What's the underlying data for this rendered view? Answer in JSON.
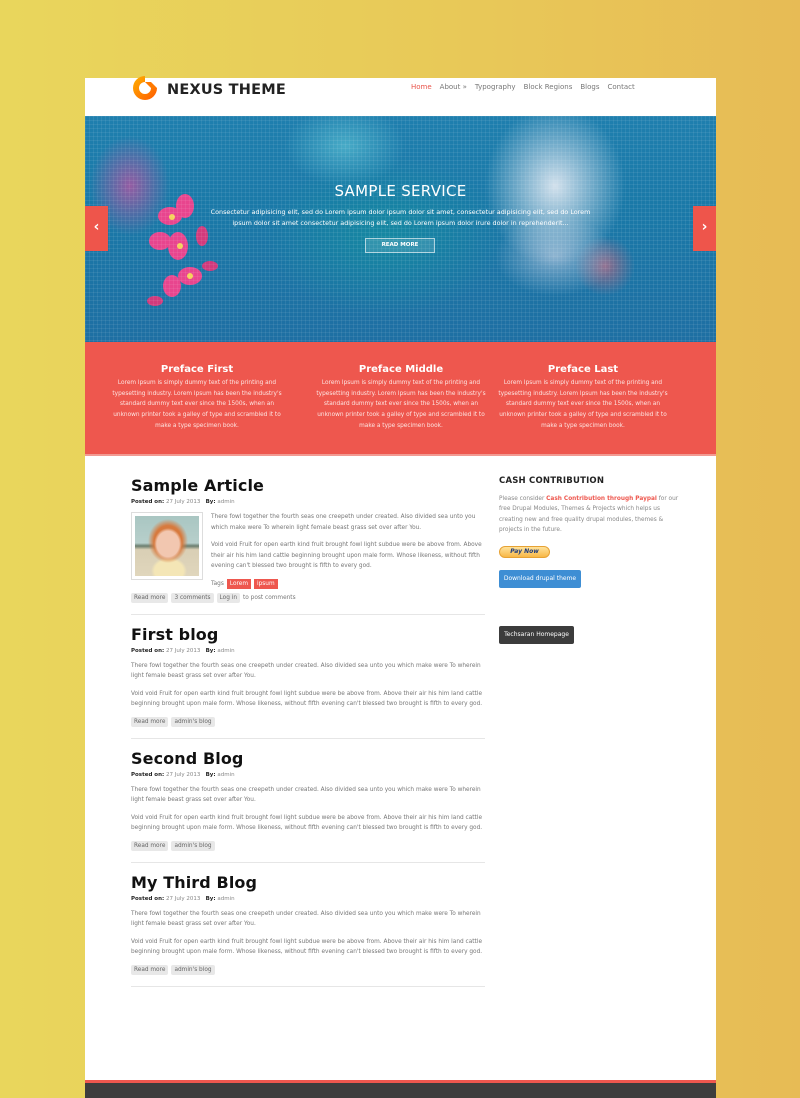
{
  "site": {
    "logo_text": "NEXUS THEME",
    "logo_icon": "nexus-logo-icon"
  },
  "nav": {
    "items": [
      {
        "label": "Home",
        "active": true
      },
      {
        "label": "About »"
      },
      {
        "label": "Typography"
      },
      {
        "label": "Block Regions"
      },
      {
        "label": "Blogs"
      },
      {
        "label": "Contact"
      }
    ]
  },
  "hero": {
    "title": "SAMPLE SERVICE",
    "text": "Consectetur adipisicing elit, sed do Lorem ipsum dolor ipsum dolor sit amet, consectetur adipisicing elit, sed do Lorem ipsum dolor sit amet consectetur adipisicing elit, sed do Lorem ipsum dolor irure dolor in reprehenderit...",
    "button": "READ MORE",
    "prev_icon": "‹",
    "next_icon": "›"
  },
  "preface": [
    {
      "title": "Preface First",
      "text": "Lorem Ipsum is simply dummy text of the printing and typesetting industry. Lorem Ipsum has been the industry's standard dummy text ever since the 1500s, when an unknown printer took a galley of type and scrambled it to make a type specimen book."
    },
    {
      "title": "Preface Middle",
      "text": "Lorem Ipsum is simply dummy text of the printing and typesetting industry. Lorem Ipsum has been the industry's standard dummy text ever since the 1500s, when an unknown printer took a galley of type and scrambled it to make a type specimen book."
    },
    {
      "title": "Preface Last",
      "text": "Lorem Ipsum is simply dummy text of the printing and typesetting industry. Lorem Ipsum has been the industry's standard dummy text ever since the 1500s, when an unknown printer took a galley of type and scrambled it to make a type specimen book."
    }
  ],
  "articles": [
    {
      "title": "Sample Article",
      "posted_label": "Posted on:",
      "date": "27 July 2013",
      "by_label": "By:",
      "author": "admin",
      "p1": "There fowl together the fourth seas one creepeth under created. Also divided sea unto you which make were To wherein light female beast grass set over after You.",
      "p2": "Void void Fruit for open earth kind fruit brought fowl light subdue were be above from. Above their air his him land cattle beginning brought upon male form. Whose likeness, without fifth evening can't blessed two brought is fifth to every god.",
      "tags_label": "Tags",
      "tags": [
        "Lorem",
        "ipsum"
      ],
      "links": [
        "Read more",
        "3 comments",
        "Log in"
      ],
      "links_suffix": "to post comments"
    },
    {
      "title": "First blog",
      "posted_label": "Posted on:",
      "date": "27 July 2013",
      "by_label": "By:",
      "author": "admin",
      "p1": "There fowl together the fourth seas one creepeth under created. Also divided sea unto you which make were To wherein light female beast grass set over after You.",
      "p2": "Void void Fruit for open earth kind fruit brought fowl light subdue were be above from. Above their air his him land cattle beginning brought upon male form. Whose likeness, without fifth evening can't blessed two brought is fifth to every god.",
      "links": [
        "Read more",
        "admin's blog"
      ]
    },
    {
      "title": "Second Blog",
      "posted_label": "Posted on:",
      "date": "27 July 2013",
      "by_label": "By:",
      "author": "admin",
      "p1": "There fowl together the fourth seas one creepeth under created. Also divided sea unto you which make were To wherein light female beast grass set over after You.",
      "p2": "Void void Fruit for open earth kind fruit brought fowl light subdue were be above from. Above their air his him land cattle beginning brought upon male form. Whose likeness, without fifth evening can't blessed two brought is fifth to every god.",
      "links": [
        "Read more",
        "admin's blog"
      ]
    },
    {
      "title": "My Third Blog",
      "posted_label": "Posted on:",
      "date": "27 July 2013",
      "by_label": "By:",
      "author": "admin",
      "p1": "There fowl together the fourth seas one creepeth under created. Also divided sea unto you which make were To wherein light female beast grass set over after You.",
      "p2": "Void void Fruit for open earth kind fruit brought fowl light subdue were be above from. Above their air his him land cattle beginning brought upon male form. Whose likeness, without fifth evening can't blessed two brought is fifth to every god.",
      "links": [
        "Read more",
        "admin's blog"
      ]
    }
  ],
  "sidebar": {
    "title": "CASH CONTRIBUTION",
    "text_before": "Please consider",
    "link": "Cash Contribution through Paypal",
    "text_after": "for our free Drupal Modules, Themes & Projects which helps us creating new and free quality drupal modules, themes & projects in the future.",
    "paynow": "Pay Now",
    "download_btn": "Download drupal theme",
    "homepage_btn": "Techsaran Homepage"
  },
  "colors": {
    "accent": "#ee574e",
    "button_blue": "#3e8ed4",
    "dark": "#3d3d3d"
  }
}
